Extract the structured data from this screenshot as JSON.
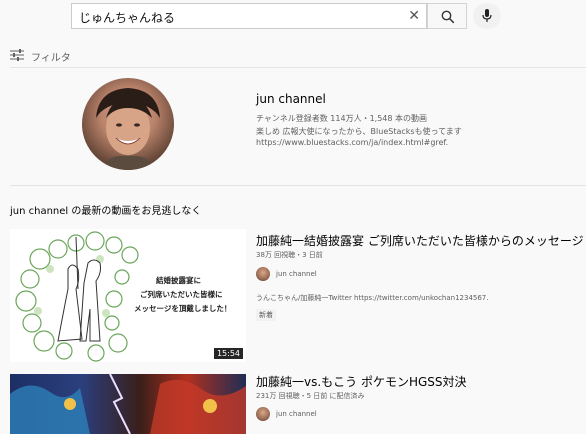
{
  "search": {
    "query": "じゅんちゃんねる"
  },
  "filter": {
    "label": "フィルタ"
  },
  "channel": {
    "name": "jun channel",
    "stats": "チャンネル登録者数 114万人・1,548 本の動画",
    "description": "楽しめ 広報大使になったから、BlueStacksも使ってます",
    "url": "https://www.bluestacks.com/ja/index.html#gref."
  },
  "section": {
    "title": "jun channel の最新の動画をお見逃しなく"
  },
  "videos": [
    {
      "title": "加藤純一結婚披露宴 ご列席いただいた皆様からのメッセージ",
      "meta": "38万 回視聴・3 日前",
      "channel": "jun channel",
      "description": "うんこちゃん/加藤純一Twitter https://twitter.com/unkochan1234567.",
      "badge": "新着",
      "duration": "15:54",
      "thumb_text": [
        "結婚披露宴に",
        "ご列席いただいた皆様に",
        "メッセージを頂戴しました！"
      ]
    },
    {
      "title": "加藤純一vs.もこう ポケモンHGSS対決",
      "meta": "231万 回視聴・5 日前 に配信済み",
      "channel": "jun channel"
    }
  ],
  "colors": {
    "background": "#f9f9f9",
    "text_primary": "#030303",
    "text_secondary": "#606060"
  }
}
